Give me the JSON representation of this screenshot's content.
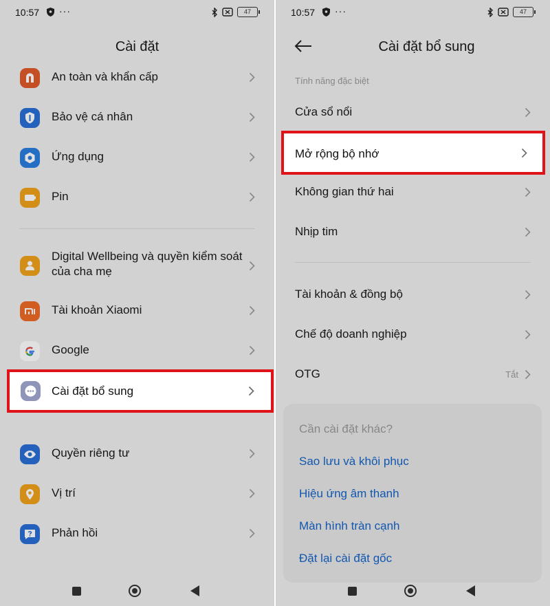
{
  "colors": {
    "highlight_border": "#e0121a",
    "link": "#1463c8",
    "background": "#f0f0f0"
  },
  "status_bar": {
    "time": "10:57",
    "dots": "···",
    "battery": "47"
  },
  "left": {
    "title": "Cài đặt",
    "group1": [
      {
        "label": "An toàn và khẩn cấp",
        "icon": "emergency-icon",
        "color": "#e05a2b"
      },
      {
        "label": "Bảo vệ cá nhân",
        "icon": "shield-icon",
        "color": "#2a6fd6"
      },
      {
        "label": "Ứng dụng",
        "icon": "apps-icon",
        "color": "#2a7ee0"
      },
      {
        "label": "Pin",
        "icon": "battery-icon",
        "color": "#f1a21c"
      }
    ],
    "group2": [
      {
        "label": "Digital Wellbeing và quyền kiểm soát của cha mẹ",
        "icon": "wellbeing-icon",
        "color": "#f1a21c"
      },
      {
        "label": "Tài khoản Xiaomi",
        "icon": "xiaomi-icon",
        "color": "#f06a28"
      },
      {
        "label": "Google",
        "icon": "google-icon",
        "color": "#ffffff"
      }
    ],
    "highlighted": {
      "label": "Cài đặt bổ sung",
      "icon": "more-icon",
      "color": "#8f95b8"
    },
    "group3": [
      {
        "label": "Quyền riêng tư",
        "icon": "eye-icon",
        "color": "#2a6fd6"
      },
      {
        "label": "Vị trí",
        "icon": "location-icon",
        "color": "#f1a21c"
      },
      {
        "label": "Phản hồi",
        "icon": "feedback-icon",
        "color": "#2a6fd6"
      }
    ]
  },
  "right": {
    "title": "Cài đặt bổ sung",
    "section_header": "Tính năng đặc biệt",
    "items1": [
      {
        "label": "Cửa sổ nổi"
      }
    ],
    "highlighted": {
      "label": "Mở rộng bộ nhớ"
    },
    "items2": [
      {
        "label": "Không gian thứ hai"
      },
      {
        "label": "Nhịp tim"
      }
    ],
    "items3": [
      {
        "label": "Tài khoản & đồng bộ"
      },
      {
        "label": "Chế độ doanh nghiệp"
      },
      {
        "label": "OTG",
        "value": "Tắt"
      }
    ],
    "card": {
      "question": "Cần cài đặt khác?",
      "links": [
        "Sao lưu và khôi phục",
        "Hiệu ứng âm thanh",
        "Màn hình tràn cạnh",
        "Đặt lại cài đặt gốc"
      ]
    }
  }
}
